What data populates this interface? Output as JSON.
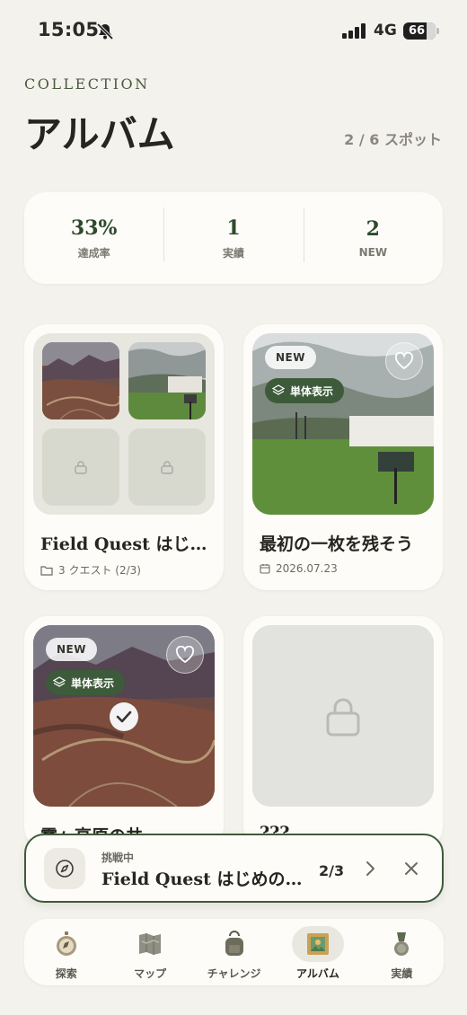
{
  "status": {
    "time": "15:05",
    "network": "4G",
    "battery": "66"
  },
  "header": {
    "eyebrow": "COLLECTION",
    "title": "アルバム",
    "spot_count": "2 / 6 スポット"
  },
  "stats": [
    {
      "value": "33%",
      "label": "達成率"
    },
    {
      "value": "1",
      "label": "実績"
    },
    {
      "value": "2",
      "label": "NEW"
    }
  ],
  "cards": {
    "a": {
      "title": "Field Quest はじ…",
      "meta": "3 クエスト (2/3)"
    },
    "b": {
      "title": "最初の一枚を残そう",
      "date": "2026.07.23",
      "badge_new": "NEW",
      "badge_single": "単体表示"
    },
    "c": {
      "title": "霧ヶ高原の共",
      "badge_new": "NEW",
      "badge_single": "単体表示"
    },
    "d": {
      "title": "???"
    }
  },
  "challenge": {
    "label": "挑戦中",
    "title": "Field Quest はじめの…",
    "progress": "2/3"
  },
  "tabs": [
    {
      "label": "探索",
      "icon": "compass-icon"
    },
    {
      "label": "マップ",
      "icon": "map-icon"
    },
    {
      "label": "チャレンジ",
      "icon": "backpack-icon"
    },
    {
      "label": "アルバム",
      "icon": "album-icon",
      "active": true
    },
    {
      "label": "実績",
      "icon": "medal-icon"
    }
  ]
}
